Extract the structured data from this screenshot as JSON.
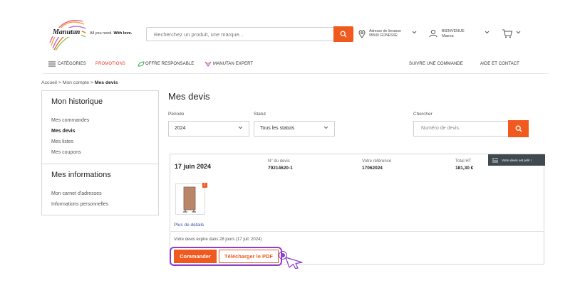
{
  "header": {
    "logo_text": "Manutan",
    "slogan_prefix": "All you need.",
    "slogan_bold": "With love.",
    "search_placeholder": "Recherchez un produit, une marque...",
    "delivery_label": "Adresse de livraison",
    "delivery_value": "95500 GONESSE",
    "user_greeting": "BIENVENUE",
    "user_name": "Maeva"
  },
  "nav": {
    "categories": "CATÉGORIES",
    "promotions": "PROMOTIONS",
    "offre": "OFFRE RESPONSABLE",
    "expert": "MANUTAN EXPERT",
    "suivre": "SUIVRE UNE COMMANDE",
    "aide": "AIDE ET CONTACT"
  },
  "breadcrumb": {
    "home": "Accueil",
    "account": "Mon compte",
    "current": "Mes devis",
    "sep": ">"
  },
  "sidebar": {
    "historique_title": "Mon historique",
    "historique_items": [
      "Mes commandes",
      "Mes devis",
      "Mes listes",
      "Mes coupons"
    ],
    "infos_title": "Mes informations",
    "infos_items": [
      "Mon carnet d'adresses",
      "Informations personnelles"
    ]
  },
  "main": {
    "title": "Mes devis",
    "filters": {
      "periode_label": "Période",
      "periode_value": "2024",
      "statut_label": "Statut",
      "statut_value": "Tous les statuts",
      "chercher_label": "Chercher",
      "chercher_placeholder": "Numéro de devis"
    },
    "quote": {
      "date": "17 juin 2024",
      "num_label": "N° du devis",
      "num_value": "79214620-1",
      "ref_label": "Votre référence",
      "ref_value": "17062024",
      "total_label": "Total HT",
      "total_value": "181,30 €",
      "badge": "1",
      "details_link": "Plus de détails",
      "expiry": "Votre devis expire dans 28 jours (17 juil. 2024)",
      "order_button": "Commander",
      "pdf_button": "Télécharger le PDF",
      "tooltip": "Votre devis est prêt !"
    }
  },
  "colors": {
    "accent": "#f05a1f",
    "promo": "#e03a2d",
    "highlight": "#8a3fd1",
    "link": "#3b55a8"
  }
}
